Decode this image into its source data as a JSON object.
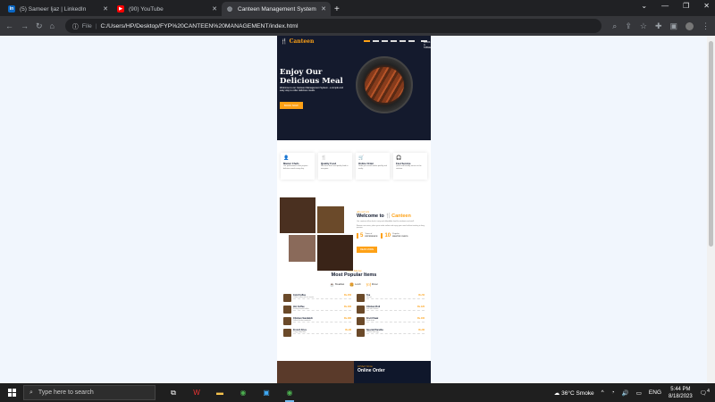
{
  "browser": {
    "tabs": [
      {
        "title": "(5) Sameer Ijaz | LinkedIn",
        "icon": "linkedin-icon",
        "active": false
      },
      {
        "title": "(90) YouTube",
        "icon": "youtube-icon",
        "active": false
      },
      {
        "title": "Canteen Management System",
        "icon": "globe-icon",
        "active": true
      }
    ],
    "address": {
      "scheme_label": "File",
      "url": "C:/Users/HP/Desktop/FYP%20CANTEEN%20MANAGEMENT/index.html"
    }
  },
  "site": {
    "brand": "Canteen",
    "book_label": "BOOK A TABLE",
    "hero": {
      "title": "Enjoy Our Delicious Meal",
      "text": "Welcome to our Canteen Management System - a simple and easy way to order delicious meals.",
      "button": "BOOK NOW"
    },
    "services": [
      {
        "title": "Master Chefs",
        "desc": "Our professional chefs prepare delicious meals every day."
      },
      {
        "title": "Quality Food",
        "desc": "We serve fresh and quality food to everyone."
      },
      {
        "title": "Online Order",
        "desc": "Order your meals online quickly and easily."
      },
      {
        "title": "Fast Service",
        "desc": "Quick and friendly service at the canteen."
      }
    ],
    "about": {
      "kicker": "About Us",
      "title_prefix": "Welcome to",
      "title_brand": "Canteen",
      "desc1": "Our canteen offers fresh, tasty and affordable food for students and staff.",
      "desc2": "Browse our menu, place your order online and enjoy your meal without waiting in long queues.",
      "stats": [
        {
          "num": "5",
          "label1": "Years of",
          "label2": "EXPERIENCE"
        },
        {
          "num": "10",
          "label1": "Popular",
          "label2": "MASTER CHEFS"
        }
      ],
      "button": "READ MORE"
    },
    "menu": {
      "kicker": "Food Menu",
      "title": "Most Popular Items",
      "tabs": [
        "Breakfast",
        "Lunch",
        "Dinner"
      ],
      "items": [
        {
          "name": "Cold Coffee",
          "price": "Rs.150",
          "desc": "Chilled coffee with ice cream"
        },
        {
          "name": "Tea",
          "price": "Rs.50",
          "desc": "Hot tea"
        },
        {
          "name": "Hot Coffee",
          "price": "Rs.100",
          "desc": "Freshly brewed coffee"
        },
        {
          "name": "Chicken Roll",
          "price": "Rs.120",
          "desc": "Roll with chicken"
        },
        {
          "name": "Chicken Sandwich",
          "price": "Rs.180",
          "desc": "Grilled chicken sandwich"
        },
        {
          "name": "Fruit Chaat",
          "price": "Rs.100",
          "desc": "Fresh fruits"
        },
        {
          "name": "French Fries",
          "price": "Rs.90",
          "desc": "Crispy salted fries"
        },
        {
          "name": "Special Paratha",
          "price": "Rs.80",
          "desc": "Paratha with egg"
        }
      ]
    },
    "order": {
      "kicker": "Order Now",
      "title": "Online Order"
    }
  },
  "taskbar": {
    "search_placeholder": "Type here to search",
    "weather": "36°C  Smoke",
    "lang": "ENG",
    "time": "5:44 PM",
    "date": "8/18/2023",
    "notifications": "4"
  },
  "colors": {
    "accent": "#fea116",
    "hero_bg": "#141a2d",
    "viewport_bg": "#f1f6fd"
  }
}
